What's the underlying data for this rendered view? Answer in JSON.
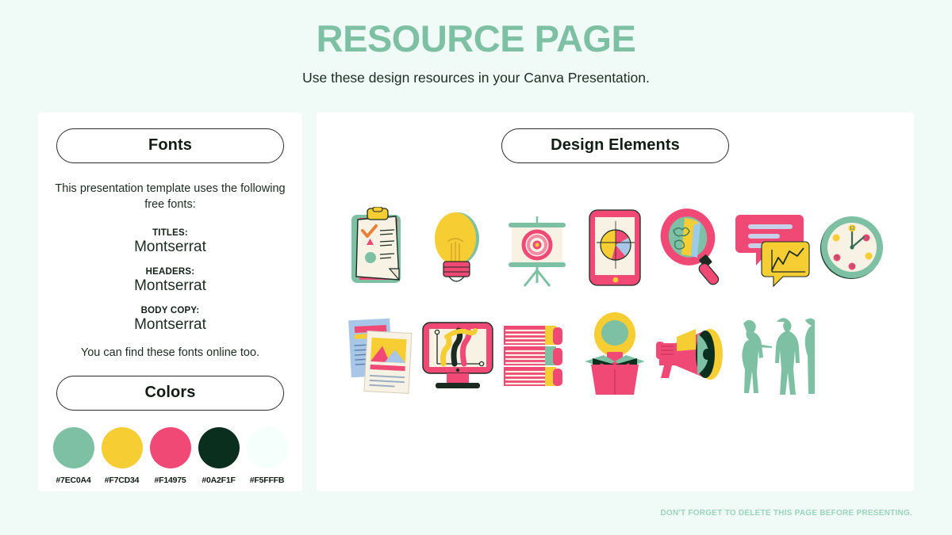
{
  "header": {
    "title": "RESOURCE PAGE",
    "subtitle": "Use these design resources in your Canva Presentation."
  },
  "fonts_panel": {
    "heading": "Fonts",
    "intro": "This presentation template uses the following free fonts:",
    "items": [
      {
        "role": "TITLES:",
        "name": "Montserrat"
      },
      {
        "role": "HEADERS:",
        "name": "Montserrat"
      },
      {
        "role": "BODY COPY:",
        "name": "Montserrat"
      }
    ],
    "outro": "You can find these fonts online too."
  },
  "colors_panel": {
    "heading": "Colors",
    "swatches": [
      {
        "hex": "#7EC0A4",
        "label": "#7EC0A4"
      },
      {
        "hex": "#F7CD34",
        "label": "#F7CD34"
      },
      {
        "hex": "#F14975",
        "label": "#F14975"
      },
      {
        "hex": "#0A2F1F",
        "label": "#0A2F1F"
      },
      {
        "hex": "#F5FFFB",
        "label": "#F5FFFB"
      }
    ]
  },
  "design_panel": {
    "heading": "Design Elements",
    "elements": [
      {
        "name": "clipboard-checklist-illustration"
      },
      {
        "name": "lightbulb-illustration"
      },
      {
        "name": "presentation-board-target-illustration"
      },
      {
        "name": "tablet-pie-chart-illustration"
      },
      {
        "name": "magnifying-glass-brain-illustration"
      },
      {
        "name": "speech-bubbles-chart-illustration"
      },
      {
        "name": "wall-clock-illustration"
      },
      {
        "name": "documents-report-illustration"
      },
      {
        "name": "monitor-chart-illustration"
      },
      {
        "name": "stack-of-books-illustration"
      },
      {
        "name": "lightbulb-in-box-illustration"
      },
      {
        "name": "megaphone-illustration"
      },
      {
        "name": "people-silhouettes-illustration"
      }
    ]
  },
  "footer": {
    "note": "DON'T FORGET TO DELETE THIS PAGE BEFORE PRESENTING."
  },
  "theme": {
    "page_background": "#F0FBF7",
    "panel_background": "#FFFFFF",
    "title_color": "#7EC0A4",
    "green": "#7EC0A4",
    "yellow": "#F7CD34",
    "pink": "#F14975",
    "dark": "#0A2F1F",
    "cream": "#F7F2E4",
    "footer_color": "#9AD3BC"
  }
}
